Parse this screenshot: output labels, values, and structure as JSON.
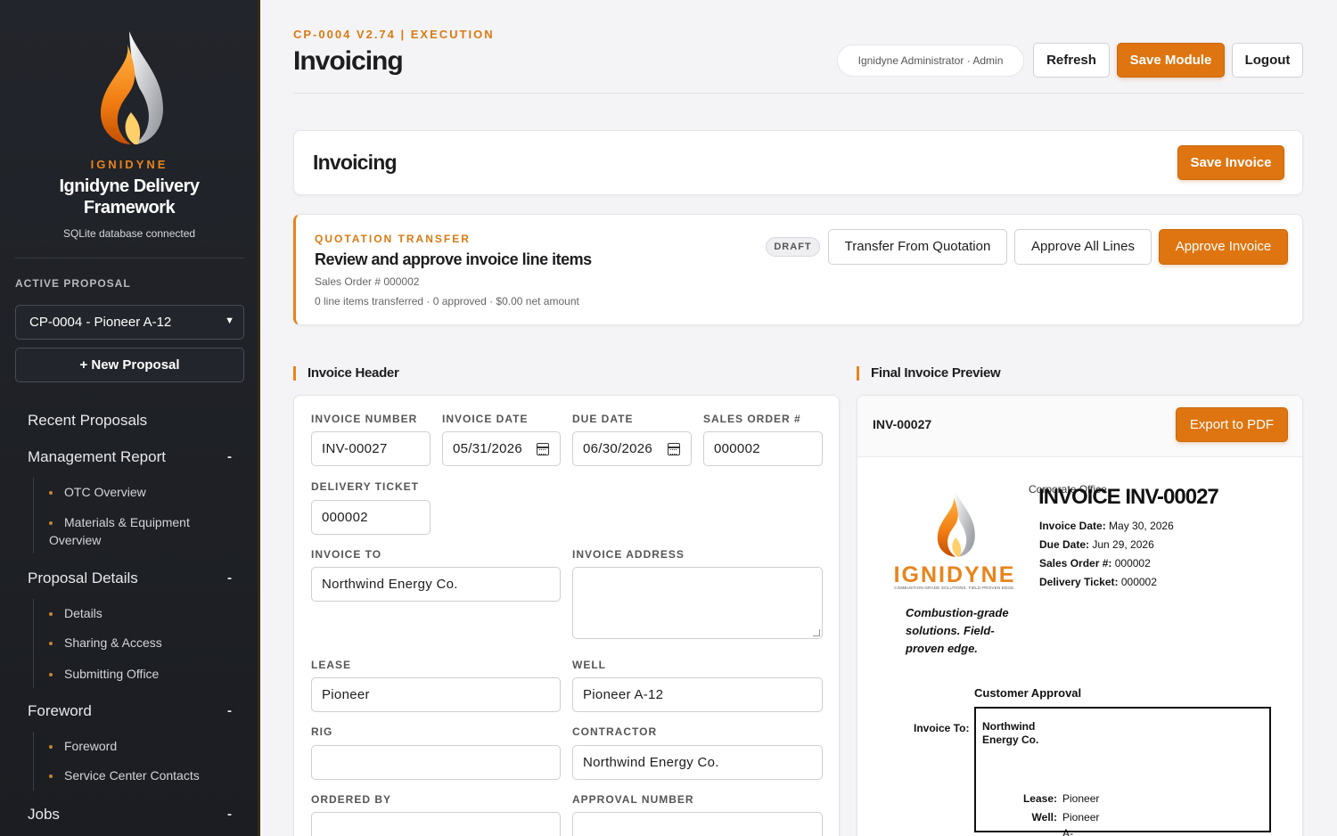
{
  "sidebar": {
    "brand": "IGNIDYNE",
    "app_title": "Ignidyne Delivery Framework",
    "db_status": "SQLite database connected",
    "active_label": "ACTIVE PROPOSAL",
    "active_proposal": "CP-0004 - Pioneer A-12",
    "new_proposal": "+ New Proposal",
    "nav": {
      "recent": "Recent Proposals",
      "management": "Management Report",
      "management_items": [
        "OTC Overview",
        "Materials & Equipment Overview"
      ],
      "proposal_details": "Proposal Details",
      "proposal_items": [
        "Details",
        "Sharing & Access",
        "Submitting Office"
      ],
      "foreword": "Foreword",
      "foreword_items": [
        "Foreword",
        "Service Center Contacts"
      ],
      "jobs": "Jobs",
      "collapse": "-"
    }
  },
  "header": {
    "crumb": "CP-0004 V2.74 | EXECUTION",
    "title": "Invoicing",
    "user": "Ignidyne Administrator · Admin",
    "refresh": "Refresh",
    "save_module": "Save Module",
    "logout": "Logout"
  },
  "invoicing_card": {
    "title": "Invoicing",
    "save_invoice": "Save Invoice"
  },
  "quotation": {
    "label": "QUOTATION TRANSFER",
    "title": "Review and approve invoice line items",
    "sales_order": "Sales Order # 000002",
    "summary": "0 line items transferred · 0 approved · $0.00 net amount",
    "status": "DRAFT",
    "transfer": "Transfer From Quotation",
    "approve_all": "Approve All Lines",
    "approve_invoice": "Approve Invoice"
  },
  "invoice_header": {
    "section_title": "Invoice Header",
    "labels": {
      "invoice_number": "INVOICE NUMBER",
      "invoice_date": "INVOICE DATE",
      "due_date": "DUE DATE",
      "sales_order": "SALES ORDER #",
      "delivery_ticket": "DELIVERY TICKET",
      "invoice_to": "INVOICE TO",
      "invoice_address": "INVOICE ADDRESS",
      "lease": "LEASE",
      "well": "WELL",
      "rig": "RIG",
      "contractor": "CONTRACTOR",
      "ordered_by": "ORDERED BY",
      "approval_number": "APPROVAL NUMBER"
    },
    "values": {
      "invoice_number": "INV-00027",
      "invoice_date": "05/31/2026",
      "due_date": "06/30/2026",
      "sales_order": "000002",
      "delivery_ticket": "000002",
      "invoice_to": "Northwind Energy Co.",
      "invoice_address": "",
      "lease": "Pioneer",
      "well": "Pioneer A-12",
      "rig": "",
      "contractor": "Northwind Energy Co.",
      "ordered_by": "",
      "approval_number": ""
    }
  },
  "preview": {
    "section_title": "Final Invoice Preview",
    "invoice_id": "INV-00027",
    "export": "Export to PDF",
    "logo_text": "IGNIDYNE",
    "logo_sub": "COMBUSTION-GRADE SOLUTIONS. FIELD-PROVEN EDGE.",
    "corporate": "Corporate Office",
    "title": "INVOICE INV-00027",
    "invoice_date_label": "Invoice Date:",
    "invoice_date": "May 30, 2026",
    "due_date_label": "Due Date:",
    "due_date": "Jun 29, 2026",
    "sales_order_label": "Sales Order #:",
    "sales_order": "000002",
    "delivery_ticket_label": "Delivery Ticket:",
    "delivery_ticket": "000002",
    "tagline": "Combustion-grade solutions. Field-proven edge.",
    "customer_approval": "Customer Approval",
    "invoice_to_label": "Invoice To:",
    "invoice_to": "Northwind Energy Co.",
    "lease_label": "Lease:",
    "lease": "Pioneer",
    "well_label": "Well:",
    "well": "Pioneer",
    "well_cont": "A-"
  },
  "colors": {
    "accent": "#de7510",
    "sidebar_bg": "#1f2227",
    "page_bg": "#f4f4f6"
  }
}
